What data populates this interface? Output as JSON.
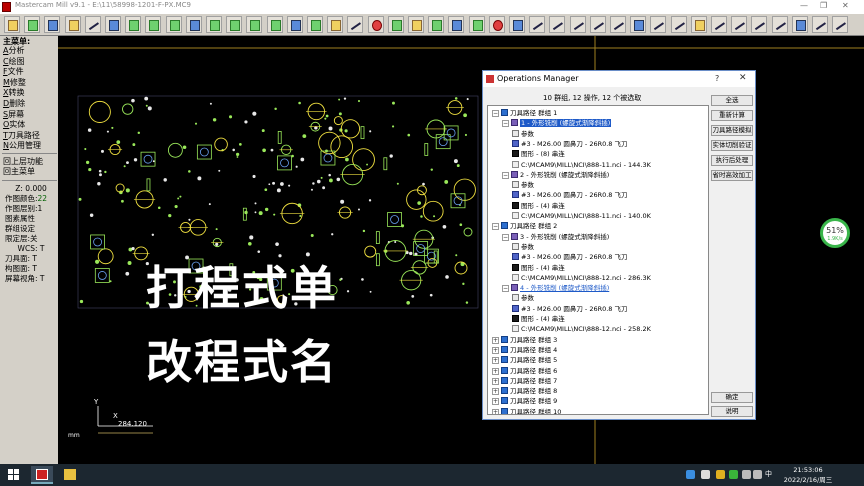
{
  "window": {
    "title": "Mastercam Mill v9.1 - E:\\11\\58998-1201-F-PX.MC9",
    "controls": [
      "—",
      "❐",
      "✕"
    ]
  },
  "left_menu": {
    "header": "主菜单:",
    "items": [
      {
        "key": "A",
        "label": "分析"
      },
      {
        "key": "C",
        "label": "绘图"
      },
      {
        "key": "F",
        "label": "文件"
      },
      {
        "key": "M",
        "label": "修整"
      },
      {
        "key": "X",
        "label": "转换"
      },
      {
        "key": "D",
        "label": "删除"
      },
      {
        "key": "S",
        "label": "屏幕"
      },
      {
        "key": "O",
        "label": "实体"
      },
      {
        "key": "T",
        "label": "刀具路径"
      },
      {
        "key": "N",
        "label": "公用管理"
      }
    ],
    "back_label": "回上层功能",
    "main_label": "回主菜单",
    "status": {
      "z": "Z:  0.000",
      "color_label": "作图颜色:",
      "color_value": "22",
      "layer": "作图层别:1",
      "attr": "图素属性",
      "group": "群组设定",
      "limit": "限定层:关",
      "wcs": "WCS: T",
      "tool_plane": "刀具面: T",
      "construct_plane": "构图面: T",
      "view": "屏幕视角: T"
    }
  },
  "overlay": {
    "line1": "打程式单",
    "line2": "改程式名"
  },
  "canvas": {
    "axis_y": "Y",
    "axis_x": "X",
    "coord_readout": "284.120",
    "units": "mm"
  },
  "progress": {
    "percent": "51%",
    "sub": "1.9K/s",
    "value": 0.51
  },
  "ops_manager": {
    "title": "Operations Manager",
    "help": "?",
    "close": "✕",
    "summary": "10 群组, 12 操作, 12 个被选取",
    "tree": [
      {
        "indent": 0,
        "icon": "grp",
        "exp": "-",
        "label": "刀具路径 群组 1"
      },
      {
        "indent": 1,
        "icon": "op",
        "exp": "-",
        "label": "1 - 外形铣削 (螺旋式渐降斜插)",
        "state": "sel"
      },
      {
        "indent": 2,
        "icon": "par",
        "exp": "",
        "label": "参数"
      },
      {
        "indent": 2,
        "icon": "tool",
        "exp": "",
        "label": "#3 - M26.00 圆鼻刀 - 26R0.8 飞刀"
      },
      {
        "indent": 2,
        "icon": "geo",
        "exp": "",
        "label": "图形 - (8) 串连"
      },
      {
        "indent": 2,
        "icon": "nci",
        "exp": "",
        "label": "C:\\MCAM9\\MILL\\NCI\\888-11.nci - 144.3K"
      },
      {
        "indent": 1,
        "icon": "op",
        "exp": "-",
        "label": "2 - 外形铣削 (螺旋式渐降斜插)"
      },
      {
        "indent": 2,
        "icon": "par",
        "exp": "",
        "label": "参数"
      },
      {
        "indent": 2,
        "icon": "tool",
        "exp": "",
        "label": "#3 - M26.00 圆鼻刀 - 26R0.8 飞刀"
      },
      {
        "indent": 2,
        "icon": "geo",
        "exp": "",
        "label": "图形 - (4) 串连"
      },
      {
        "indent": 2,
        "icon": "nci",
        "exp": "",
        "label": "C:\\MCAM9\\MILL\\NCI\\888-11.nci - 140.0K"
      },
      {
        "indent": 0,
        "icon": "grp",
        "exp": "-",
        "label": "刀具路径 群组 2"
      },
      {
        "indent": 1,
        "icon": "op",
        "exp": "-",
        "label": "3 - 外形铣削 (螺旋式渐降斜插)"
      },
      {
        "indent": 2,
        "icon": "par",
        "exp": "",
        "label": "参数"
      },
      {
        "indent": 2,
        "icon": "tool",
        "exp": "",
        "label": "#3 - M26.00 圆鼻刀 - 26R0.8 飞刀"
      },
      {
        "indent": 2,
        "icon": "geo",
        "exp": "",
        "label": "图形 - (4) 串连"
      },
      {
        "indent": 2,
        "icon": "nci",
        "exp": "",
        "label": "C:\\MCAM9\\MILL\\NCI\\888-12.nci - 286.3K"
      },
      {
        "indent": 1,
        "icon": "op",
        "exp": "-",
        "label": "4 - 外形铣削 (螺旋式渐降斜插)",
        "state": "hov"
      },
      {
        "indent": 2,
        "icon": "par",
        "exp": "",
        "label": "参数"
      },
      {
        "indent": 2,
        "icon": "tool",
        "exp": "",
        "label": "#3 - M26.00 圆鼻刀 - 26R0.8 飞刀"
      },
      {
        "indent": 2,
        "icon": "geo",
        "exp": "",
        "label": "图形 - (4) 串连"
      },
      {
        "indent": 2,
        "icon": "nci",
        "exp": "",
        "label": "C:\\MCAM9\\MILL\\NCI\\888-12.nci - 258.2K"
      },
      {
        "indent": 0,
        "icon": "grp",
        "exp": "+",
        "label": "刀具路径 群组 3"
      },
      {
        "indent": 0,
        "icon": "grp",
        "exp": "+",
        "label": "刀具路径 群组 4"
      },
      {
        "indent": 0,
        "icon": "grp",
        "exp": "+",
        "label": "刀具路径 群组 5"
      },
      {
        "indent": 0,
        "icon": "grp",
        "exp": "+",
        "label": "刀具路径 群组 6"
      },
      {
        "indent": 0,
        "icon": "grp",
        "exp": "+",
        "label": "刀具路径 群组 7"
      },
      {
        "indent": 0,
        "icon": "grp",
        "exp": "+",
        "label": "刀具路径 群组 8"
      },
      {
        "indent": 0,
        "icon": "grp",
        "exp": "+",
        "label": "刀具路径 群组 9"
      },
      {
        "indent": 0,
        "icon": "grp",
        "exp": "+",
        "label": "刀具路径 群组 10"
      }
    ],
    "buttons": {
      "select_all": "全选",
      "regen": "重新计算",
      "backplot": "刀具路径模拟",
      "verify": "实体切削验证",
      "post": "执行后处理",
      "hsm": "省时高效加工",
      "ok": "确定",
      "help": "说明"
    }
  },
  "taskbar": {
    "ime": "中",
    "time": "21:53:06",
    "date": "2022/2/16/周三"
  },
  "colors": {
    "canvas_bg": "#000000",
    "geometry_green": "#9ae85a",
    "geometry_yellow": "#f0e040",
    "crosshair": "#a08020",
    "selected": "#1e5ac8"
  }
}
